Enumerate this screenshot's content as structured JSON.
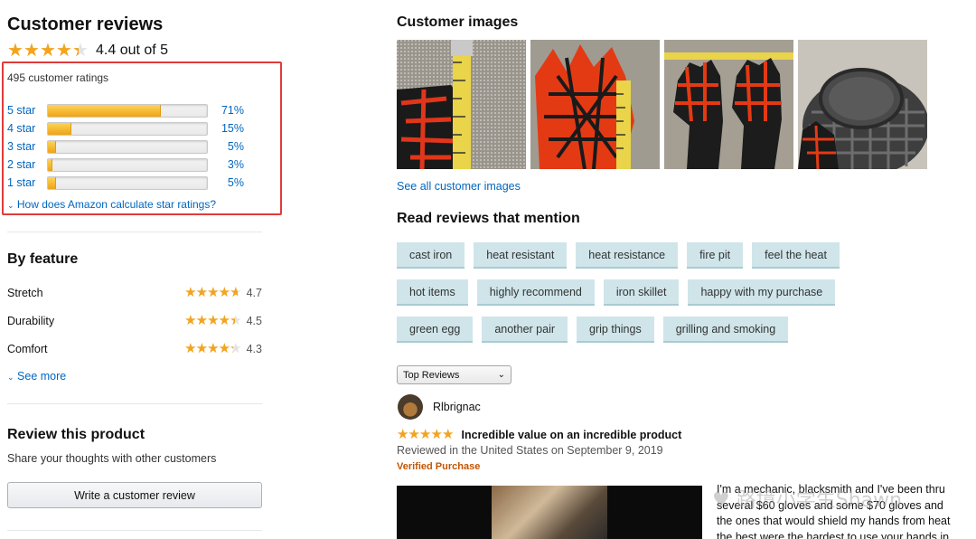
{
  "colors": {
    "link": "#0066c0",
    "star": "#f4a41c",
    "highlight_box": "#e03b3b",
    "chip_bg": "#cfe5ea",
    "verified": "#c45500"
  },
  "reviews_summary": {
    "title": "Customer reviews",
    "rating_value": 4.4,
    "rating_text": "4.4 out of 5",
    "ratings_count_text": "495 customer ratings",
    "histogram": [
      {
        "label": "5 star",
        "percent": 71,
        "percent_text": "71%"
      },
      {
        "label": "4 star",
        "percent": 15,
        "percent_text": "15%"
      },
      {
        "label": "3 star",
        "percent": 5,
        "percent_text": "5%"
      },
      {
        "label": "2 star",
        "percent": 3,
        "percent_text": "3%"
      },
      {
        "label": "1 star",
        "percent": 5,
        "percent_text": "5%"
      }
    ],
    "calc_link": "How does Amazon calculate star ratings?"
  },
  "by_feature": {
    "title": "By feature",
    "items": [
      {
        "name": "Stretch",
        "rating": 4.7,
        "rating_text": "4.7"
      },
      {
        "name": "Durability",
        "rating": 4.5,
        "rating_text": "4.5"
      },
      {
        "name": "Comfort",
        "rating": 4.3,
        "rating_text": "4.3"
      }
    ],
    "see_more": "See more"
  },
  "review_product": {
    "title": "Review this product",
    "subtitle": "Share your thoughts with other customers",
    "button": "Write a customer review"
  },
  "customer_images": {
    "title": "Customer images",
    "see_all": "See all customer images"
  },
  "mentions": {
    "title": "Read reviews that mention",
    "rows": [
      [
        "cast iron",
        "heat resistant",
        "heat resistance",
        "fire pit",
        "feel the heat"
      ],
      [
        "hot items",
        "highly recommend",
        "iron skillet",
        "happy with my purchase"
      ],
      [
        "green egg",
        "another pair",
        "grip things",
        "grilling and smoking"
      ]
    ]
  },
  "sort": {
    "selected": "Top Reviews"
  },
  "review": {
    "author": "Rlbrignac",
    "rating": 5,
    "title": "Incredible value on an incredible product",
    "reviewed": "Reviewed in the United States on September 9, 2019",
    "verified": "Verified Purchase",
    "text": "I'm a mechanic, blacksmith and I've been thru several $60 gloves and some $70 gloves and the ones that would shield my hands from heat the best were the hardest to use your hands in... they"
  },
  "watermark": "路境小学生Shawn"
}
